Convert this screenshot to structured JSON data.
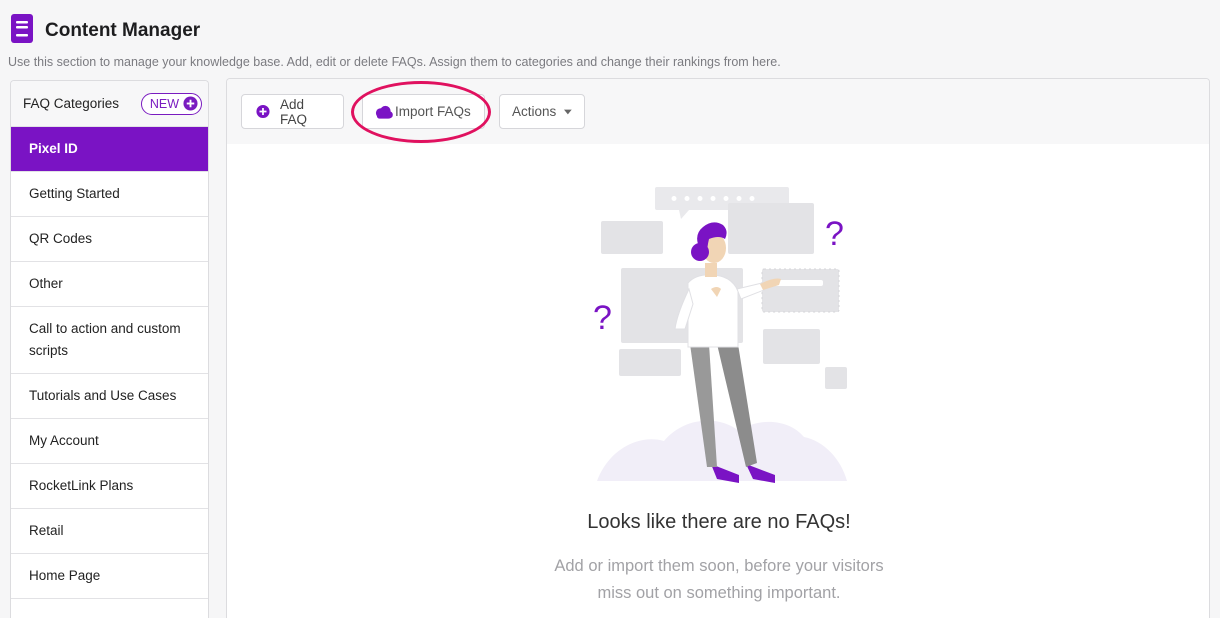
{
  "header": {
    "title": "Content Manager",
    "subtitle": "Use this section to manage your knowledge base. Add, edit or delete FAQs. Assign them to categories and change their rankings from here.",
    "icon": "book-icon"
  },
  "sidebar": {
    "title": "FAQ Categories",
    "new_label": "NEW",
    "items": [
      {
        "label": "Pixel ID",
        "active": true
      },
      {
        "label": "Getting Started"
      },
      {
        "label": "QR Codes"
      },
      {
        "label": "Other"
      },
      {
        "label": "Call to action and custom scripts"
      },
      {
        "label": "Tutorials and Use Cases"
      },
      {
        "label": "My Account"
      },
      {
        "label": "RocketLink Plans"
      },
      {
        "label": "Retail"
      },
      {
        "label": "Home Page"
      }
    ]
  },
  "toolbar": {
    "add_label": "Add FAQ",
    "import_label": "Import FAQs",
    "actions_label": "Actions"
  },
  "empty_state": {
    "title": "Looks like there are no FAQs!",
    "line1": "Add or import them soon, before your visitors",
    "line2": "miss out on something important."
  },
  "colors": {
    "accent": "#7a13c4",
    "highlight": "#e0115f"
  }
}
